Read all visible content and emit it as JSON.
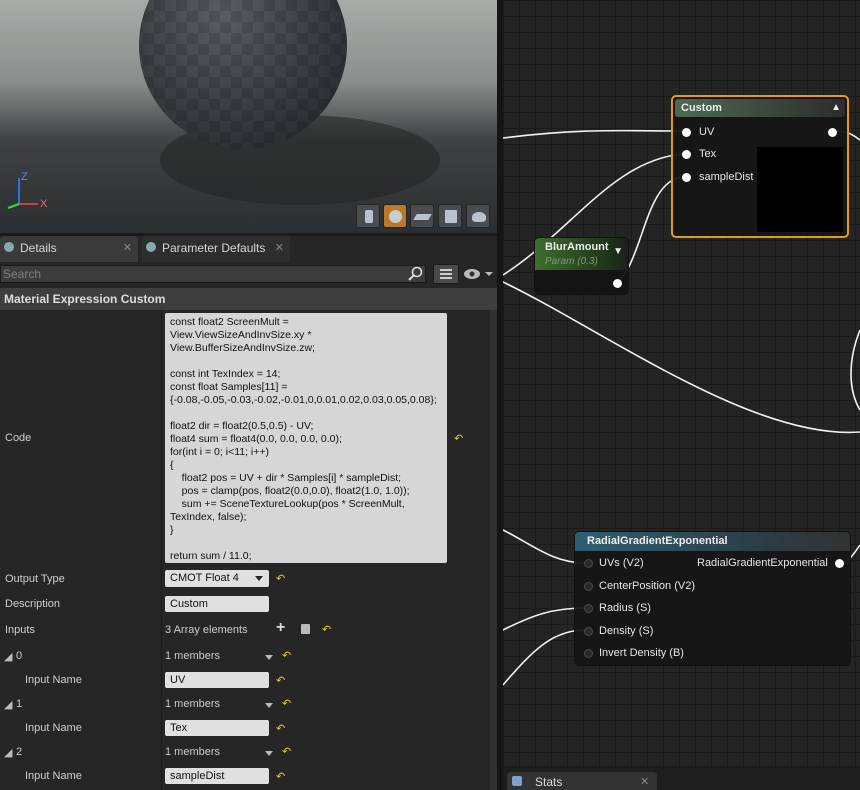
{
  "viewport": {
    "axis_z": "Z",
    "axis_x": "X",
    "buttons": [
      "cylinder-icon",
      "sphere-icon",
      "plane-icon",
      "cube-icon",
      "teapot-icon"
    ]
  },
  "details": {
    "tab_details": "Details",
    "tab_params": "Parameter Defaults",
    "search_placeholder": "Search",
    "section_title": "Material Expression Custom",
    "code_label": "Code",
    "code_lines": [
      "const float2 ScreenMult =",
      "View.ViewSizeAndInvSize.xy *",
      "View.BufferSizeAndInvSize.zw;",
      "",
      "const int TexIndex = 14;",
      "const float Samples[11] =",
      "{-0.08,-0.05,-0.03,-0.02,-0.01,0,0.01,0.02,0.03,0.05,0.08};",
      "",
      "float2 dir = float2(0.5,0.5) - UV;",
      "float4 sum = float4(0.0, 0.0, 0.0, 0.0);",
      "for(int i = 0; i<11; i++)",
      "{",
      "    float2 pos = UV + dir * Samples[i] * sampleDist;",
      "    pos = clamp(pos, float2(0.0,0.0), float2(1.0, 1.0));",
      "    sum += SceneTextureLookup(pos * ScreenMult,",
      "TexIndex, false);",
      "}",
      "",
      "return sum / 11.0;"
    ],
    "output_type_label": "Output Type",
    "output_type_value": "CMOT Float 4",
    "description_label": "Description",
    "description_value": "Custom",
    "inputs_label": "Inputs",
    "inputs_value": "3 Array elements",
    "inputs": [
      {
        "index": "0",
        "members": "1 members",
        "name_label": "Input Name",
        "name_value": "UV"
      },
      {
        "index": "1",
        "members": "1 members",
        "name_label": "Input Name",
        "name_value": "Tex"
      },
      {
        "index": "2",
        "members": "1 members",
        "name_label": "Input Name",
        "name_value": "sampleDist"
      }
    ]
  },
  "graph": {
    "custom_node": {
      "title": "Custom",
      "pins": [
        "UV",
        "Tex",
        "sampleDist"
      ]
    },
    "blur_node": {
      "title": "BlurAmount",
      "subtitle": "Param (0.3)"
    },
    "radial_node": {
      "title": "RadialGradientExponential",
      "output": "RadialGradientExponential",
      "pins": [
        "UVs (V2)",
        "CenterPosition (V2)",
        "Radius (S)",
        "Density (S)",
        "Invert Density (B)"
      ]
    }
  },
  "stats_tab": "Stats"
}
